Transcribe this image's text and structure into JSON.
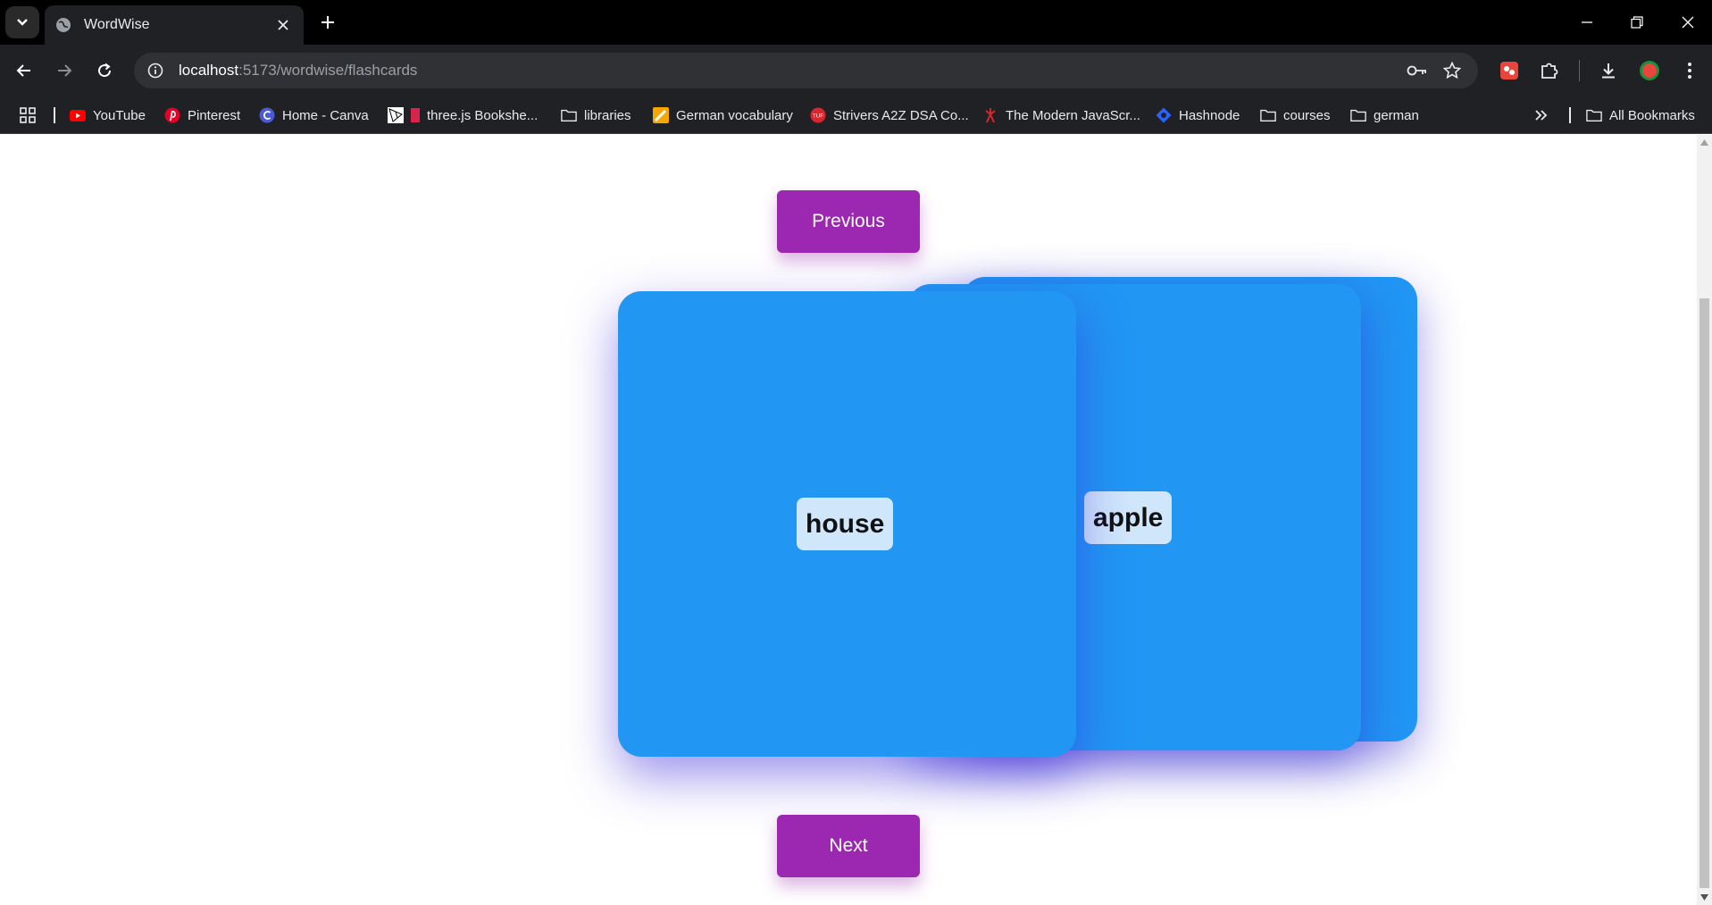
{
  "browser": {
    "tab_title": "WordWise",
    "url_host": "localhost",
    "url_path": ":5173/wordwise/flashcards",
    "bookmarks": [
      {
        "label": "YouTube",
        "icon": "youtube-icon"
      },
      {
        "label": "Pinterest",
        "icon": "pinterest-icon"
      },
      {
        "label": "Home - Canva",
        "icon": "canva-icon"
      },
      {
        "label": "three.js Bookshe...",
        "icon": "threejs-icon"
      },
      {
        "label": "libraries",
        "icon": "folder-icon"
      },
      {
        "label": "German vocabulary",
        "icon": "pencil-icon"
      },
      {
        "label": "Strivers A2Z DSA Co...",
        "icon": "tuf-icon"
      },
      {
        "label": "The Modern JavaScr...",
        "icon": "javascript-info-icon"
      },
      {
        "label": "Hashnode",
        "icon": "hashnode-icon"
      },
      {
        "label": "courses",
        "icon": "folder-icon"
      },
      {
        "label": "german",
        "icon": "folder-icon"
      }
    ],
    "all_bookmarks_label": "All Bookmarks"
  },
  "flashcards": {
    "previous_label": "Previous",
    "next_label": "Next",
    "front_card_word": "house",
    "back_card_word": "apple",
    "button_color": "#9c27b0",
    "card_color": "#2196f3"
  }
}
